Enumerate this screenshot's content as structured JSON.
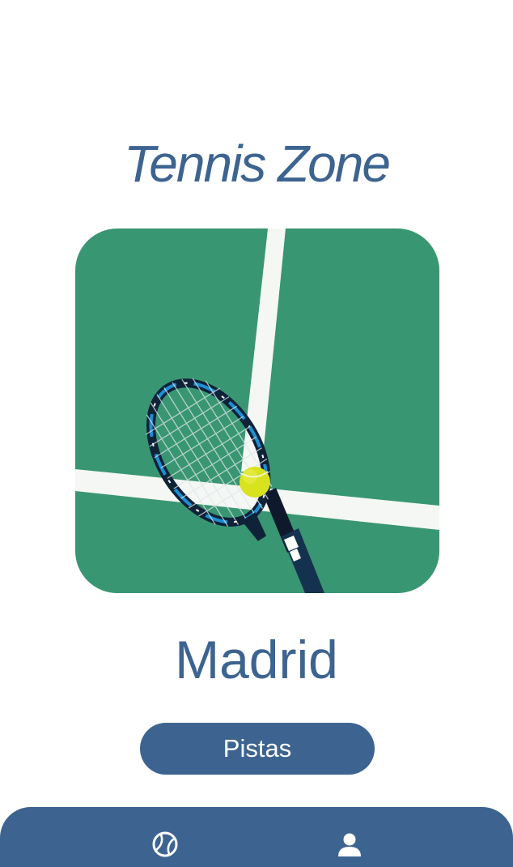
{
  "header": {
    "title": "Tennis Zone"
  },
  "hero": {
    "image": "tennis-racket-and-ball-on-green-court"
  },
  "main": {
    "city": "Madrid",
    "courts_button_label": "Pistas"
  },
  "bottom_nav": {
    "items": [
      {
        "icon": "tennis-ball-icon"
      },
      {
        "icon": "user-icon"
      }
    ]
  },
  "colors": {
    "primary": "#3d6490",
    "court_green": "#3d9a76",
    "background": "#ffffff"
  }
}
